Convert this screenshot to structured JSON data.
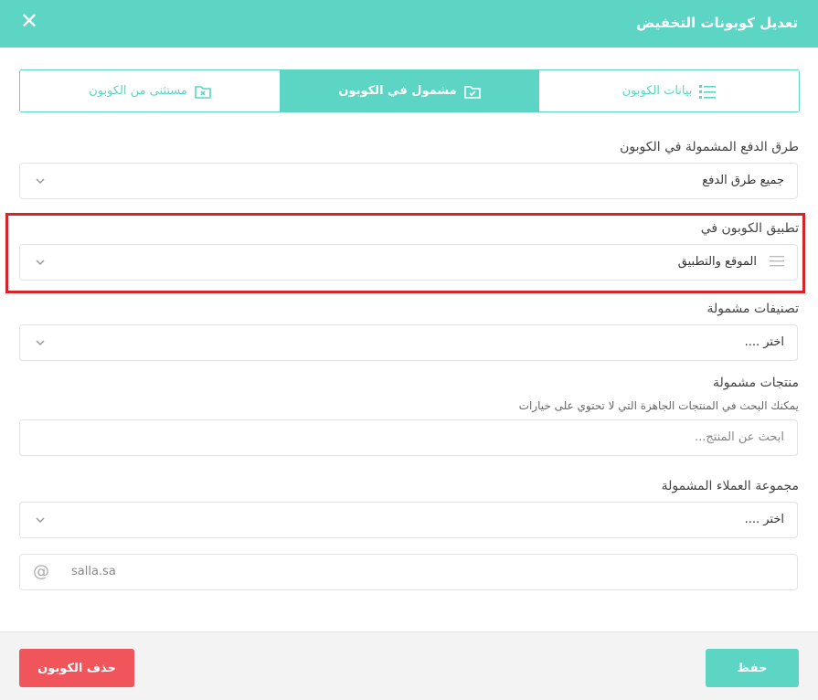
{
  "modal": {
    "title": "تعديل كوبونات التخفيض"
  },
  "tabs": [
    {
      "label": "بيانات الكوبون",
      "icon": "list-icon"
    },
    {
      "label": "مشمول في الكوبون",
      "icon": "folder-check-icon"
    },
    {
      "label": "مستثنى من الكوبون",
      "icon": "folder-x-icon"
    }
  ],
  "payment": {
    "label": "طرق الدفع المشمولة في الكوبون",
    "value": "جميع طرق الدفع"
  },
  "apply": {
    "label": "تطبيق الكوبون في",
    "value": "الموقع والتطبيق"
  },
  "categories": {
    "label": "تصنيفات مشمولة",
    "placeholder": "اختر ...."
  },
  "products": {
    "label": "منتجات مشمولة",
    "hint": "يمكنك البحث في المنتجات الجاهزة التي لا تحتوي على خيارات",
    "placeholder": "ابحث عن المنتج..."
  },
  "customers": {
    "label": "مجموعة العملاء المشمولة",
    "placeholder": "اختر ...."
  },
  "email": {
    "placeholder": "salla.sa"
  },
  "footer": {
    "save_label": "حفظ",
    "delete_label": "حذف الكوبون"
  },
  "colors": {
    "accent": "#5dd5c4",
    "danger": "#f0555b",
    "highlight": "#d7232a"
  }
}
